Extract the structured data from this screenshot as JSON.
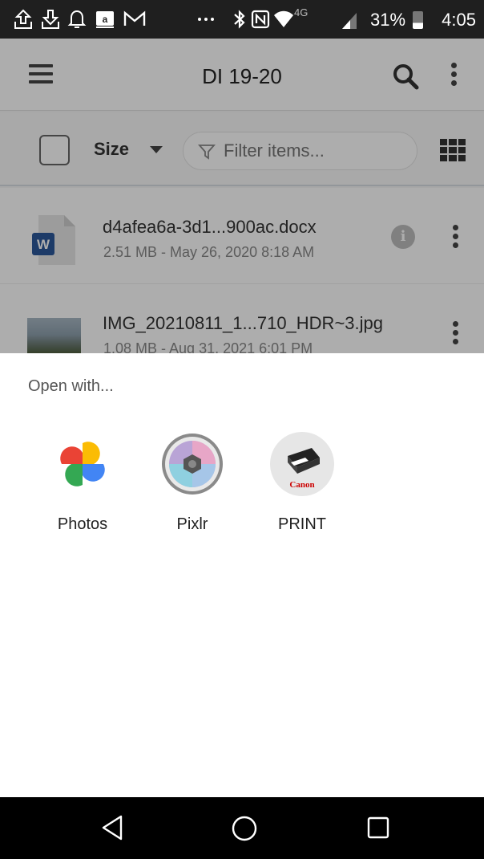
{
  "status_bar": {
    "network": "4G",
    "battery": "31%",
    "time": "4:05",
    "icons": [
      "upload-icon",
      "download-icon",
      "notification-bell-icon",
      "amazon-icon",
      "gmail-icon",
      "more-notifications-icon",
      "bluetooth-icon",
      "nfc-icon",
      "wifi-icon",
      "signal-icon",
      "battery-icon"
    ]
  },
  "app": {
    "title": "DI 19-20",
    "sort_label": "Size",
    "filter_placeholder": "Filter items...",
    "files": [
      {
        "name": "d4afea6a-3d1...900ac.docx",
        "meta": "2.51 MB - May 26, 2020 8:18 AM",
        "type": "word-doc-icon",
        "badge": "W"
      },
      {
        "name": "IMG_20210811_1...710_HDR~3.jpg",
        "meta": "1.08 MB - Aug 31, 2021 6:01 PM",
        "type": "image-thumbnail"
      }
    ]
  },
  "sheet": {
    "title": "Open with...",
    "apps": [
      {
        "label": "Photos",
        "icon": "google-photos-icon"
      },
      {
        "label": "Pixlr",
        "icon": "pixlr-icon"
      },
      {
        "label": "PRINT",
        "icon": "canon-print-icon",
        "brand": "Canon"
      }
    ]
  },
  "nav_bar": {
    "buttons": [
      "back-icon",
      "home-icon",
      "recents-icon"
    ]
  },
  "colors": {
    "status_bar": "#1f1f1f",
    "word_blue": "#2b579a",
    "canon_red": "#cc0000"
  }
}
